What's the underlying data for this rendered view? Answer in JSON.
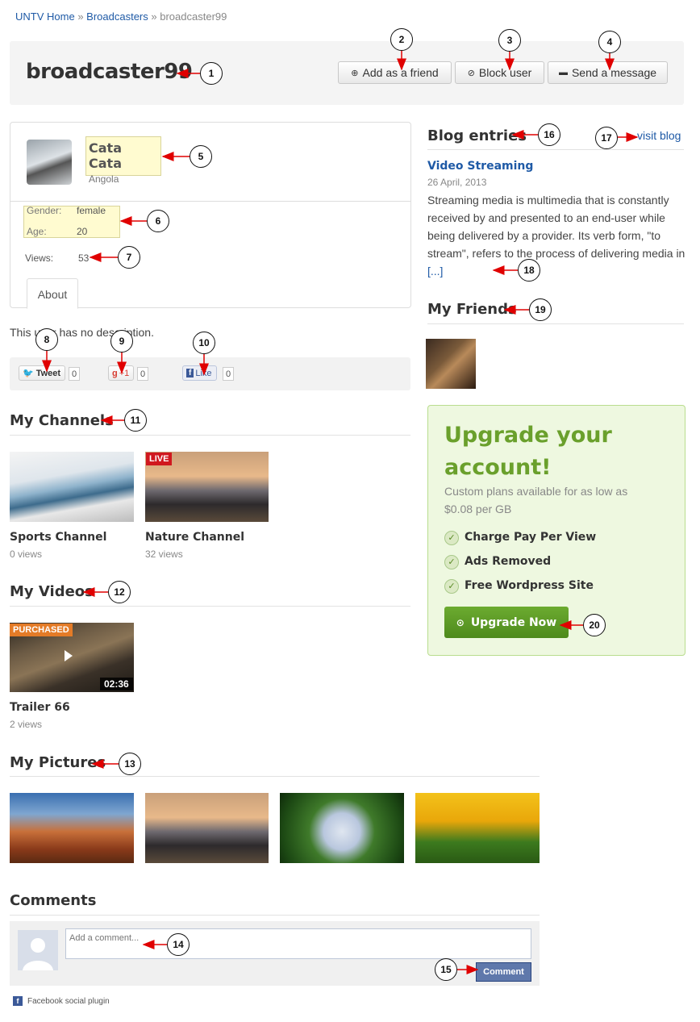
{
  "breadcrumb": {
    "home": "UNTV Home",
    "sep1": "»",
    "broadcasters": "Broadcasters",
    "sep2": "»",
    "current": "broadcaster99"
  },
  "header": {
    "title": "broadcaster99",
    "add_friend": "Add as a friend",
    "block_user": "Block user",
    "send_message": "Send a message"
  },
  "profile": {
    "name": "Cata Cata",
    "country": "Angola",
    "gender_label": "Gender:",
    "gender": "female",
    "age_label": "Age:",
    "age": "20",
    "views_label": "Views:",
    "views": "53",
    "tab_about": "About",
    "description": "This user has no description."
  },
  "share": {
    "tweet": "Tweet",
    "tweet_count": "0",
    "gplus": "+1",
    "gplus_count": "0",
    "like": "Like",
    "like_count": "0"
  },
  "channels": {
    "title": "My Channels",
    "items": [
      {
        "title": "Sports Channel",
        "views": "0 views"
      },
      {
        "title": "Nature Channel",
        "views": "32 views",
        "badge": "LIVE"
      }
    ]
  },
  "videos": {
    "title": "My Videos",
    "items": [
      {
        "title": "Trailer 66",
        "views": "2 views",
        "badge": "PURCHASED",
        "duration": "02:36"
      }
    ]
  },
  "pictures": {
    "title": "My Pictures"
  },
  "comments": {
    "title": "Comments",
    "placeholder": "Add a comment...",
    "button": "Comment",
    "plugin": "Facebook social plugin"
  },
  "blog": {
    "title": "Blog entries",
    "visit": "visit blog",
    "entry_title": "Video Streaming",
    "entry_date": "26 April, 2013",
    "entry_text": "Streaming media is multimedia that is constantly received by and presented to an end-user while being delivered by a provider. Its verb form, \"to stream\", refers to the process of delivering media in",
    "more": "[...]"
  },
  "friends": {
    "title": "My Friends"
  },
  "upgrade": {
    "title": "Upgrade your account!",
    "subtitle": "Custom plans available for as low as $0.08 per GB",
    "features": [
      "Charge Pay Per View",
      "Ads Removed",
      "Free Wordpress Site"
    ],
    "button": "Upgrade Now"
  },
  "callouts": [
    "1",
    "2",
    "3",
    "4",
    "5",
    "6",
    "7",
    "8",
    "9",
    "10",
    "11",
    "12",
    "13",
    "14",
    "15",
    "16",
    "17",
    "18",
    "19",
    "20"
  ],
  "colors": {
    "link": "#1f5aa6",
    "upgrade_green": "#6aa02c",
    "callout_arrow": "#e00000",
    "live_badge": "#d0181f",
    "purchased_badge": "#e47b27"
  }
}
